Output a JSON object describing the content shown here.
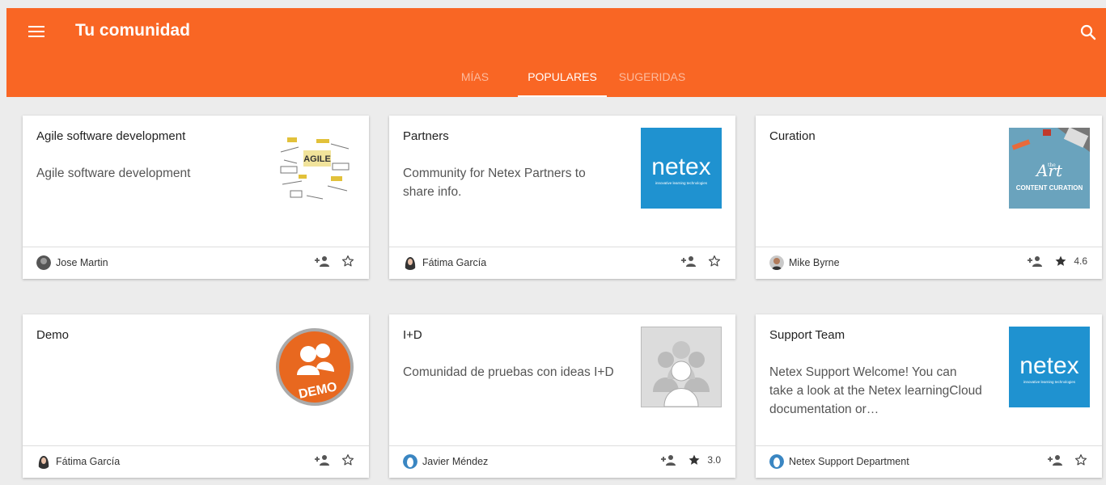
{
  "header": {
    "title": "Tu comunidad",
    "background": "#f96624"
  },
  "tabs": [
    {
      "label": "MÍAS",
      "active": false
    },
    {
      "label": "POPULARES",
      "active": true
    },
    {
      "label": "SUGERIDAS",
      "active": false
    }
  ],
  "communities": [
    {
      "title": "Agile software development",
      "description": "Agile software development",
      "author": "Jose Martin",
      "rating": "",
      "starred": false,
      "thumb": "agile-wordcloud"
    },
    {
      "title": "Partners",
      "description": "Community for Netex Partners to share info.",
      "author": "Fátima García",
      "rating": "",
      "starred": false,
      "thumb": "netex-logo"
    },
    {
      "title": "Curation",
      "description": "",
      "author": "Mike Byrne",
      "rating": "4.6",
      "starred": true,
      "thumb": "content-curation"
    },
    {
      "title": "Demo",
      "description": "",
      "author": "Fátima García",
      "rating": "",
      "starred": false,
      "thumb": "demo-badge"
    },
    {
      "title": "I+D",
      "description": "Comunidad de pruebas con ideas I+D",
      "author": "Javier Méndez",
      "rating": "3.0",
      "starred": true,
      "thumb": "group-placeholder"
    },
    {
      "title": "Support Team",
      "description": "Netex Support Welcome! You can take a look at the Netex learningCloud documentation or…",
      "author": "Netex Support Department",
      "rating": "",
      "starred": false,
      "thumb": "netex-logo"
    }
  ],
  "thumb_text": {
    "agile": "AGILE",
    "netex": "netex",
    "netex_tagline": "innovative learning technologies",
    "curation_the": "the",
    "curation_art": "Art",
    "curation_caption": "CONTENT CURATION",
    "demo": "DEMO"
  },
  "icons": {
    "menu": "menu-icon",
    "search": "search-icon",
    "join": "add-person-icon",
    "star": "star-icon"
  }
}
